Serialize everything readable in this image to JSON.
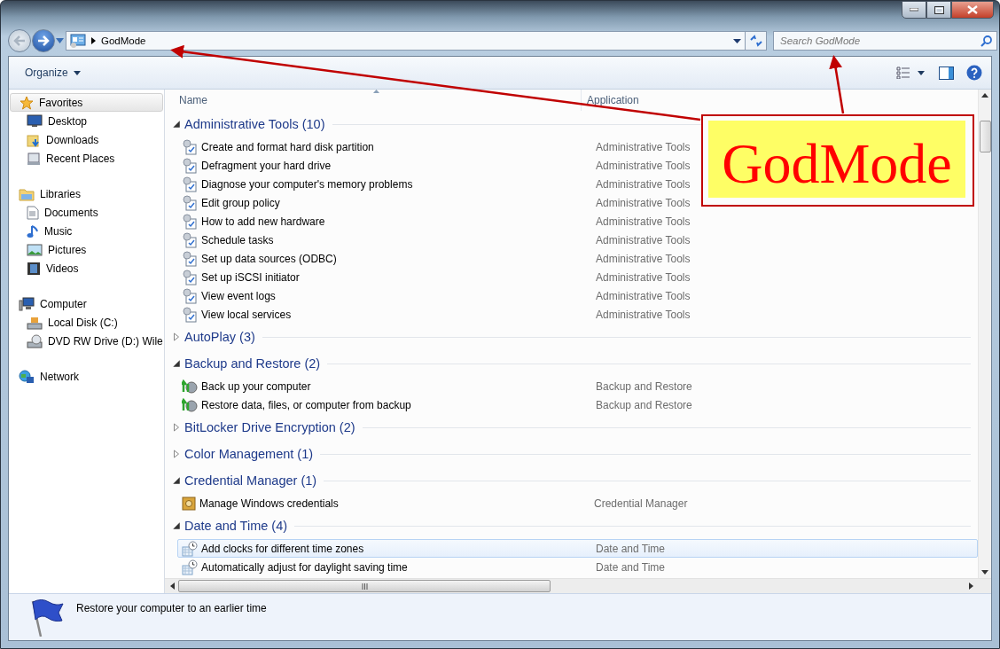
{
  "address_bar": {
    "path": "GodMode"
  },
  "search": {
    "placeholder": "Search GodMode"
  },
  "toolbar": {
    "organize": "Organize"
  },
  "sidebar": {
    "sections": [
      {
        "label": "Favorites",
        "kind": "favorites",
        "selected": true,
        "children": [
          {
            "label": "Desktop",
            "kind": "desktop",
            "selected": false
          },
          {
            "label": "Downloads",
            "kind": "downloads",
            "selected": false
          },
          {
            "label": "Recent Places",
            "kind": "recent",
            "selected": false
          }
        ]
      },
      {
        "label": "Libraries",
        "kind": "libraries",
        "selected": false,
        "children": [
          {
            "label": "Documents",
            "kind": "documents",
            "selected": false
          },
          {
            "label": "Music",
            "kind": "music",
            "selected": false
          },
          {
            "label": "Pictures",
            "kind": "pictures",
            "selected": false
          },
          {
            "label": "Videos",
            "kind": "videos",
            "selected": false
          }
        ]
      },
      {
        "label": "Computer",
        "kind": "computer",
        "selected": false,
        "children": [
          {
            "label": "Local Disk (C:)",
            "kind": "disk",
            "selected": false
          },
          {
            "label": "DVD RW Drive (D:) Wile",
            "kind": "dvd",
            "selected": false
          }
        ]
      },
      {
        "label": "Network",
        "kind": "network",
        "selected": false
      }
    ]
  },
  "table": {
    "columns": [
      {
        "label": "Name",
        "sorted": true
      },
      {
        "label": "Application",
        "sorted": false
      }
    ],
    "groups": [
      {
        "title": "Administrative Tools (10)",
        "expanded": true,
        "items": [
          {
            "name": "Create and format hard disk partition",
            "application": "Administrative Tools",
            "kind": "admin",
            "selected": false
          },
          {
            "name": "Defragment your hard drive",
            "application": "Administrative Tools",
            "kind": "admin",
            "selected": false
          },
          {
            "name": "Diagnose your computer's memory problems",
            "application": "Administrative Tools",
            "kind": "admin",
            "selected": false
          },
          {
            "name": "Edit group policy",
            "application": "Administrative Tools",
            "kind": "admin",
            "selected": false
          },
          {
            "name": "How to add new hardware",
            "application": "Administrative Tools",
            "kind": "admin",
            "selected": false
          },
          {
            "name": "Schedule tasks",
            "application": "Administrative Tools",
            "kind": "admin",
            "selected": false
          },
          {
            "name": "Set up data sources (ODBC)",
            "application": "Administrative Tools",
            "kind": "admin",
            "selected": false
          },
          {
            "name": "Set up iSCSI initiator",
            "application": "Administrative Tools",
            "kind": "admin",
            "selected": false
          },
          {
            "name": "View event logs",
            "application": "Administrative Tools",
            "kind": "admin",
            "selected": false
          },
          {
            "name": "View local services",
            "application": "Administrative Tools",
            "kind": "admin",
            "selected": false
          }
        ]
      },
      {
        "title": "AutoPlay (3)",
        "expanded": false
      },
      {
        "title": "Backup and Restore (2)",
        "expanded": true,
        "items": [
          {
            "name": "Back up your computer",
            "application": "Backup and Restore",
            "kind": "backup",
            "selected": false
          },
          {
            "name": "Restore data, files, or computer from backup",
            "application": "Backup and Restore",
            "kind": "backup",
            "selected": false
          }
        ]
      },
      {
        "title": "BitLocker Drive Encryption (2)",
        "expanded": false
      },
      {
        "title": "Color Management (1)",
        "expanded": false
      },
      {
        "title": "Credential Manager (1)",
        "expanded": true,
        "items": [
          {
            "name": "Manage Windows credentials",
            "application": "Credential Manager",
            "kind": "credential",
            "selected": false
          }
        ]
      },
      {
        "title": "Date and Time (4)",
        "expanded": true,
        "items": [
          {
            "name": "Add clocks for different time zones",
            "application": "Date and Time",
            "kind": "datetime",
            "selected": true
          },
          {
            "name": "Automatically adjust for daylight saving time",
            "application": "Date and Time",
            "kind": "datetime",
            "selected": false
          }
        ]
      }
    ]
  },
  "details_pane": {
    "text": "Restore your computer to an earlier time"
  },
  "annotation": {
    "label": "GodMode"
  }
}
